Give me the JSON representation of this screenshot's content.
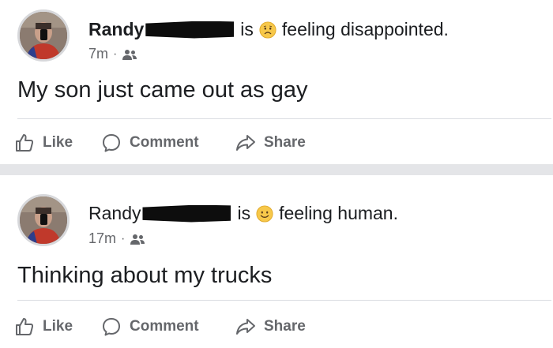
{
  "posts": [
    {
      "author": "Randy",
      "status_verb": "is",
      "feeling": "feeling disappointed.",
      "feeling_emoji": "disappointed-emoji",
      "time": "7m",
      "audience_icon": "friends-icon",
      "text": "My son just came out as gay",
      "actions": {
        "like": "Like",
        "comment": "Comment",
        "share": "Share"
      }
    },
    {
      "author": "Randy",
      "status_verb": "is",
      "feeling": "feeling human.",
      "feeling_emoji": "smiling-emoji",
      "time": "17m",
      "audience_icon": "friends-icon",
      "text": "Thinking about my trucks",
      "actions": {
        "like": "Like",
        "comment": "Comment",
        "share": "Share"
      }
    }
  ],
  "colors": {
    "text": "#1c1e21",
    "secondary_text": "#65676b",
    "divider": "#dadde1",
    "separator": "#e4e5e8",
    "emoji": "#f7c84a"
  }
}
